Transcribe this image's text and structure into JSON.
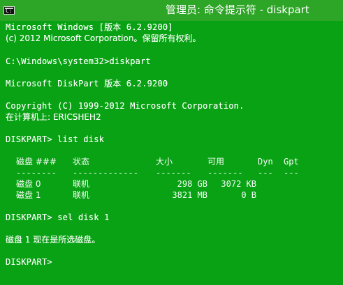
{
  "window": {
    "title": "管理员: 命令提示符 - diskpart",
    "icon": "console-icon",
    "icon_text": "C:",
    "background_color": "#09a214",
    "text_color": "#f8fff8"
  },
  "console": {
    "lines": [
      "Microsoft Windows [版本 6.2.9200]",
      "(c) 2012 Microsoft Corporation。保留所有权利。",
      "C:\\Windows\\system32>diskpart",
      "Microsoft DiskPart 版本 6.2.9200",
      "Copyright (C) 1999-2012 Microsoft Corporation.",
      "在计算机上: ERICSHEH2",
      "DISKPART> list disk",
      "DISKPART> sel disk 1",
      "磁盘 1 现在是所选磁盘。",
      "DISKPART>"
    ],
    "table": {
      "headers": [
        "磁盘 ###",
        "状态",
        "大小",
        "可用",
        "Dyn",
        "Gpt"
      ],
      "separators": [
        "--------",
        "-------------",
        "-------",
        "-------",
        "---",
        "---"
      ],
      "rows": [
        [
          "磁盘 0",
          "联机",
          "298 GB",
          "3072 KB",
          "",
          ""
        ],
        [
          "磁盘 1",
          "联机",
          "3821 MB",
          "0 B",
          "",
          ""
        ]
      ]
    }
  }
}
